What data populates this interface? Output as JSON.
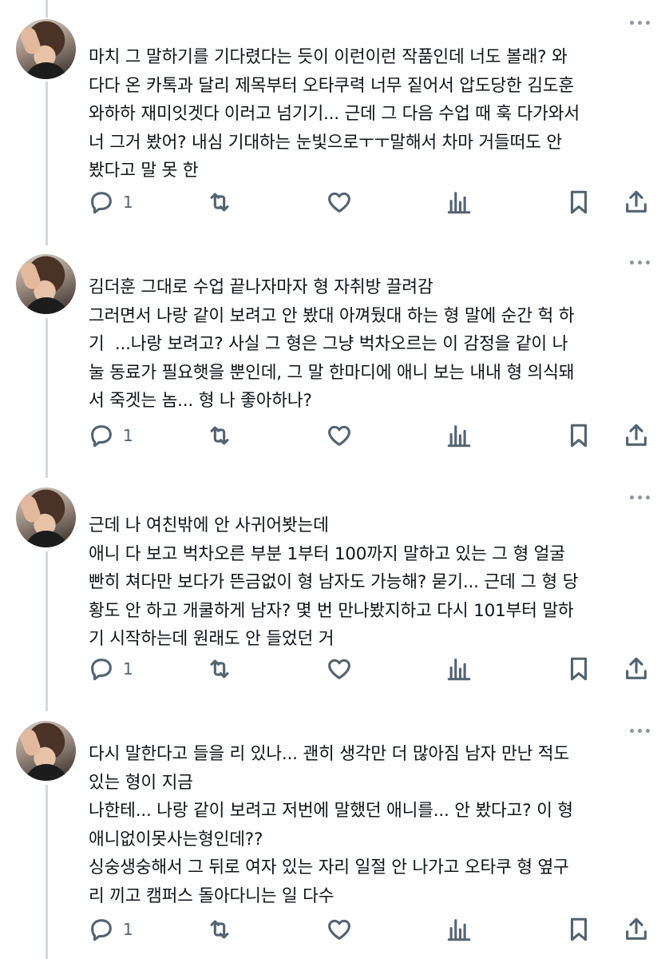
{
  "tweets": [
    {
      "text": "마치 그 말하기를 기다렸다는 듯이 이런이런 작품인데 너도 볼래? 와다다 온 카톡과 달리 제목부터 오타쿠력 너무 짙어서 압도당한 김도훈 와하하 재미잇겟다 이러고 넘기기... 근데 그 다음 수업 때 훅 다가와서 너 그거 봤어? 내심 기대하는 눈빛으로ㅜㅜ말해서 차마 거들떠도 안 봤다고 말 못 한",
      "lines": [
        "마치 그 말하기를 기다렸다는 듯이 이런이런 작품인데 너도 볼래? 와",
        "다다 온 카톡과 달리 제목부터 오타쿠력 너무 짙어서 압도당한 김도훈",
        "와하하 재미잇겟다 이러고 넘기기... 근데 그 다음 수업 때 훅 다가와서",
        "너 그거 봤어? 내심 기대하는 눈빛으로ㅜㅜ말해서 차마 거들떠도 안",
        "봤다고 말 못 한"
      ],
      "reply_count": "1"
    },
    {
      "lines": [
        "김더훈 그대로 수업 끝나자마자 형 자취방 끌려감",
        "그러면서 나랑 같이 보려고 안 봤대 아껴뒀대 하는 형 말에 순간 헉 하",
        "기  ...나랑 보려고? 사실 그 형은 그냥 벅차오르는 이 감정을 같이 나",
        "눌 동료가 필요햇을 뿐인데, 그 말 한마디에 애니 보는 내내 형 의식돼",
        "서 죽겟는 놈... 형 나 좋아하나?"
      ],
      "reply_count": "1"
    },
    {
      "lines": [
        "근데 나 여친밖에 안 사귀어봣는데",
        "애니 다 보고 벅차오른 부분 1부터 100까지 말하고 있는 그 형 얼굴",
        "빤히 쳐다만 보다가 뜬금없이 형 남자도 가능해? 묻기... 근데 그 형 당",
        "황도 안 하고 개쿨하게 남자? 몇 번 만나봤지하고 다시 101부터 말하",
        "기 시작하는데 원래도 안 들었던 거"
      ],
      "reply_count": "1"
    },
    {
      "lines": [
        "다시 말한다고 들을 리 있나... 괜히 생각만 더 많아짐 남자 만난 적도",
        "있는 형이 지금",
        "나한테... 나랑 같이 보려고 저번에 말했던 애니를... 안 봤다고? 이 형",
        "애니없이못사는형인데??",
        "싱숭생숭해서 그 뒤로 여자 있는 자리 일절 안 나가고 오타쿠 형 옆구",
        "리 끼고 캠퍼스 돌아다니는 일 다수"
      ],
      "reply_count": "1"
    }
  ],
  "icons": {
    "reply": "reply-icon",
    "retweet": "retweet-icon",
    "like": "heart-icon",
    "views": "views-icon",
    "bookmark": "bookmark-icon",
    "share": "share-icon",
    "more": "more-icon"
  },
  "colors": {
    "text": "#0f1419",
    "muted": "#536471",
    "thread_line": "#cfd9de"
  }
}
